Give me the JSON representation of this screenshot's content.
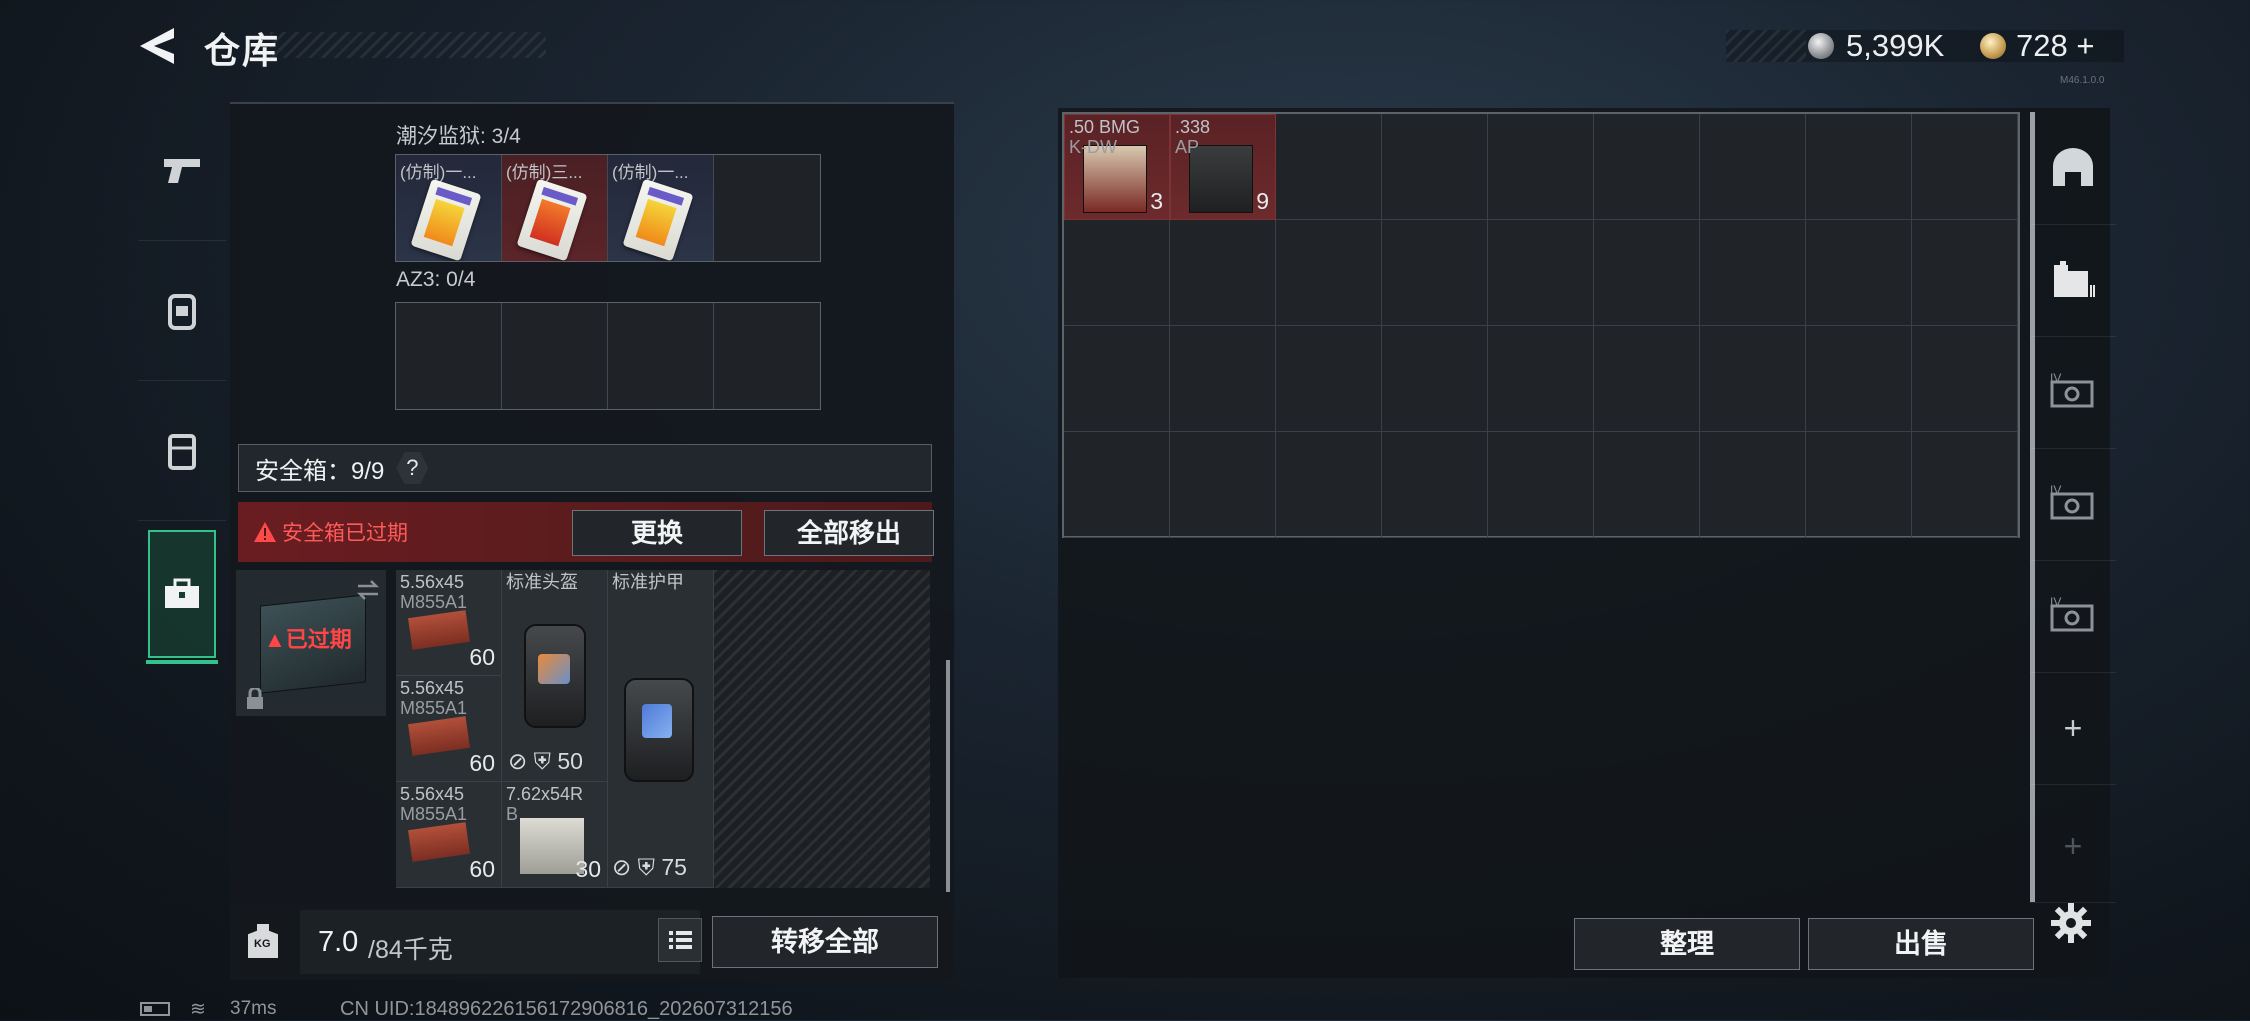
{
  "header": {
    "title": "仓库",
    "silver_amount": "5,399K",
    "gold_amount": "728",
    "gold_plus": "+",
    "version": "M46.1.0.0"
  },
  "left_tabs": [
    "pistol-icon",
    "backpack-icon",
    "chest-rig-icon",
    "safebox-icon"
  ],
  "left_tab_active": "safebox-icon",
  "containers": {
    "tide_prison": {
      "label": "潮汐监狱: 3/4",
      "items": [
        {
          "name": "(仿制)一...",
          "color": "blue"
        },
        {
          "name": "(仿制)三...",
          "color": "red"
        },
        {
          "name": "(仿制)一...",
          "color": "blue"
        }
      ]
    },
    "az3": {
      "label": "AZ3: 0/4"
    }
  },
  "safebox": {
    "header": "安全箱：9/9",
    "help": "?",
    "expired_warning": "安全箱已过期",
    "replace_label": "更换",
    "remove_all_label": "全部移出",
    "case_status": "已过期",
    "items": {
      "ammo1": {
        "line1": "5.56x45",
        "line2": "M855A1",
        "count": "60"
      },
      "ammo2": {
        "line1": "5.56x45",
        "line2": "M855A1",
        "count": "60"
      },
      "ammo3": {
        "line1": "5.56x45",
        "line2": "M855A1",
        "count": "60"
      },
      "helmet": {
        "name": "标准头盔",
        "durability": "50"
      },
      "armor": {
        "name": "标准护甲",
        "durability": "75"
      },
      "ammo4": {
        "line1": "7.62x54R",
        "line2": "B",
        "count": "30"
      }
    }
  },
  "bottom": {
    "kg": "KG",
    "weight_current": "7.0",
    "weight_max": "/84千克",
    "transfer_all_label": "转移全部"
  },
  "stash": {
    "items": [
      {
        "line1": ".50 BMG",
        "line2": "K-DW",
        "count": "3"
      },
      {
        "line1": ".338",
        "line2": "AP",
        "count": "9"
      }
    ],
    "organize_label": "整理",
    "sell_label": "出售"
  },
  "right_tabs": [
    "garage-icon",
    "folder-stash-icon",
    "iv-ticket-icon",
    "iv-ticket-icon",
    "iv-ticket-icon",
    "add-icon",
    "add-disabled-icon"
  ],
  "right_tab_text": {
    "iv": "IV",
    "plus": "+"
  },
  "status": {
    "ping": "37ms",
    "uid": "CN UID:18489622615617290681​6_202607312156"
  },
  "colors": {
    "accent_green": "#33c28a",
    "warning_red": "#ff5a5a",
    "item_red": "#6d2a2c",
    "item_blue": "#2c3448"
  }
}
